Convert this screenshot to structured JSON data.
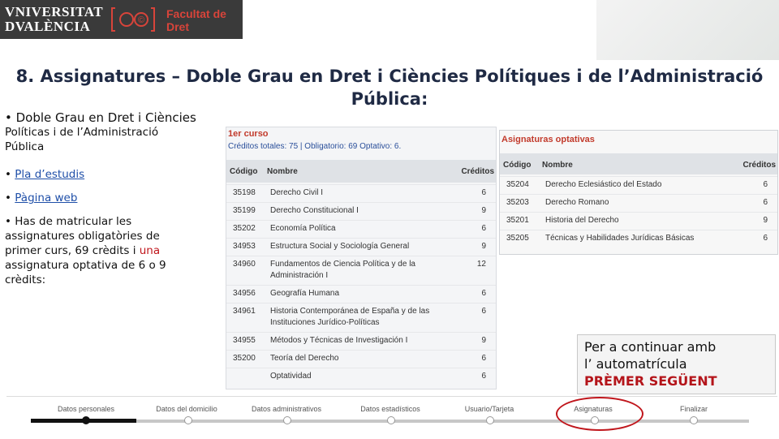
{
  "logo": {
    "univ_line1": "VNIVERSITAT",
    "univ_line2": "DVALÈNCIA",
    "faculty_line1": "Facultat de",
    "faculty_line2": "Dret"
  },
  "title": {
    "line1": "8. Assignatures –  Doble Grau en Dret i Ciències Polítiques i de l’Administració",
    "line2": "Pública:"
  },
  "left": {
    "bullet1": "• Doble Grau en Dret i Ciències",
    "bullet1b": "Políticas i de l’Administració",
    "bullet1c": "Pública",
    "link_pla": "Pla d’estudis",
    "link_web": "Pàgina web",
    "para1": "• Has de matricular les",
    "para2": "assignatures obligatòries de",
    "para3": "primer curs, 69 crèdits i ",
    "para3_red": "una",
    "para4": "assignatura optativa de 6 o 9",
    "para5": "crèdits:"
  },
  "course": {
    "heading": "1er curso",
    "credits": "Créditos totales: 75 | Obligatorio: 69  Optativo: 6.",
    "headers": {
      "code": "Código",
      "name": "Nombre",
      "credits": "Créditos"
    },
    "rows": [
      {
        "code": "35198",
        "name": "Derecho Civil I",
        "credits": "6"
      },
      {
        "code": "35199",
        "name": "Derecho Constitucional I",
        "credits": "9"
      },
      {
        "code": "35202",
        "name": "Economía Política",
        "credits": "6"
      },
      {
        "code": "34953",
        "name": "Estructura Social y Sociología General",
        "credits": "9"
      },
      {
        "code": "34960",
        "name": "Fundamentos de Ciencia Política y de la",
        "name2": "Administración I",
        "credits": "12"
      },
      {
        "code": "34956",
        "name": "Geografía Humana",
        "credits": "6"
      },
      {
        "code": "34961",
        "name": "Historia Contemporánea de España y de las",
        "name2": "Instituciones Jurídico-Políticas",
        "credits": "6"
      },
      {
        "code": "34955",
        "name": "Métodos y Técnicas de Investigación I",
        "credits": "9"
      },
      {
        "code": "35200",
        "name": "Teoría del Derecho",
        "credits": "6"
      },
      {
        "code": "",
        "name": "Optatividad",
        "credits": "6"
      }
    ]
  },
  "optional": {
    "heading": "Asignaturas optativas",
    "headers": {
      "code": "Código",
      "name": "Nombre",
      "credits": "Créditos"
    },
    "rows": [
      {
        "code": "35204",
        "name": "Derecho Eclesiástico del Estado",
        "credits": "6"
      },
      {
        "code": "35203",
        "name": "Derecho Romano",
        "credits": "6"
      },
      {
        "code": "35201",
        "name": "Historia del Derecho",
        "credits": "9"
      },
      {
        "code": "35205",
        "name": "Técnicas y Habilidades Jurídicas Básicas",
        "credits": "6"
      }
    ]
  },
  "callout": {
    "line1": "Per a continuar amb",
    "line2": "l’  automatrícula",
    "line3": "PRÈMER  SEGÜENT"
  },
  "progress": {
    "steps": [
      "Datos personales",
      "Datos del domicilio",
      "Datos administrativos",
      "Datos estadísticos",
      "Usuario/Tarjeta",
      "Asignaturas",
      "Finalizar"
    ],
    "current_step": 1,
    "highlighted_step": "Asignaturas"
  },
  "colors": {
    "accent_red": "#c0161c",
    "link_blue": "#1f4fa8",
    "title_navy": "#1f2a44"
  }
}
